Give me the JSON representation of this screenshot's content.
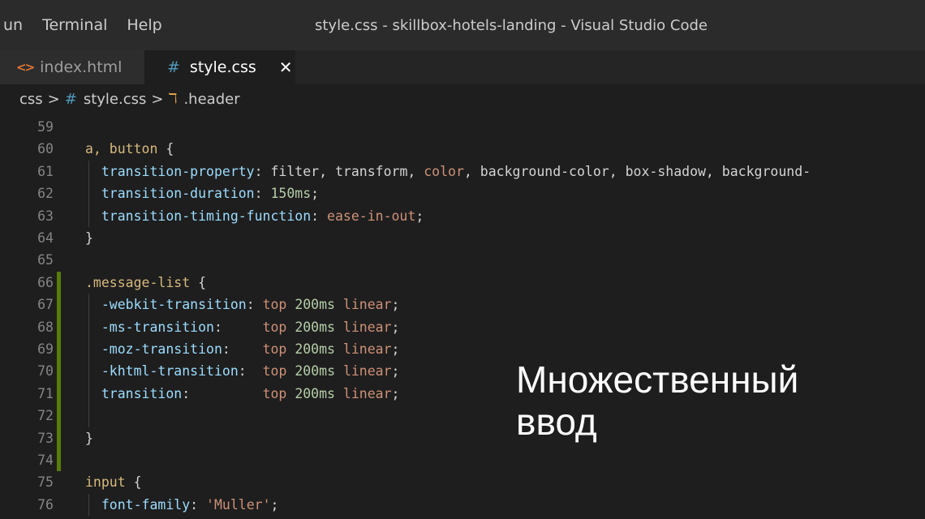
{
  "menu": [
    "un",
    "Terminal",
    "Help"
  ],
  "window_title": "style.css - skillbox-hotels-landing - Visual Studio Code",
  "tabs": [
    {
      "label": "index.html",
      "icon": "<>"
    },
    {
      "label": "style.css",
      "icon": "#",
      "close": "✕"
    }
  ],
  "breadcrumb": {
    "folder": "css",
    "sep": ">",
    "file_icon": "#",
    "file": "style.css",
    "symbol_icon": "ℸ",
    "symbol": ".header"
  },
  "lines": [
    {
      "n": "59",
      "tokens": []
    },
    {
      "n": "60",
      "tokens": [
        [
          "sel",
          "a, button "
        ],
        [
          "punc",
          "{"
        ]
      ]
    },
    {
      "n": "61",
      "tokens": [
        [
          "pad",
          "  "
        ],
        [
          "prop",
          "transition-property"
        ],
        [
          "punc",
          ": "
        ],
        [
          "punc",
          "filter, transform, "
        ],
        [
          "val",
          "color"
        ],
        [
          "punc",
          ", background-color, box-shadow, background-"
        ]
      ]
    },
    {
      "n": "62",
      "tokens": [
        [
          "pad",
          "  "
        ],
        [
          "prop",
          "transition-duration"
        ],
        [
          "punc",
          ": "
        ],
        [
          "num",
          "150ms"
        ],
        [
          "punc",
          ";"
        ]
      ]
    },
    {
      "n": "63",
      "tokens": [
        [
          "pad",
          "  "
        ],
        [
          "prop",
          "transition-timing-function"
        ],
        [
          "punc",
          ": "
        ],
        [
          "val",
          "ease-in-out"
        ],
        [
          "punc",
          ";"
        ]
      ]
    },
    {
      "n": "64",
      "tokens": [
        [
          "punc",
          "}"
        ]
      ]
    },
    {
      "n": "65",
      "tokens": []
    },
    {
      "n": "66",
      "tokens": [
        [
          "sel",
          ".message-list "
        ],
        [
          "punc",
          "{"
        ]
      ]
    },
    {
      "n": "67",
      "tokens": [
        [
          "pad",
          "  "
        ],
        [
          "prop",
          "-webkit-transition"
        ],
        [
          "punc",
          ": "
        ],
        [
          "val",
          "top "
        ],
        [
          "num",
          "200ms "
        ],
        [
          "val",
          "linear"
        ],
        [
          "punc",
          ";"
        ]
      ]
    },
    {
      "n": "68",
      "tokens": [
        [
          "pad",
          "  "
        ],
        [
          "prop",
          "-ms-transition"
        ],
        [
          "punc",
          ":     "
        ],
        [
          "val",
          "top "
        ],
        [
          "num",
          "200ms "
        ],
        [
          "val",
          "linear"
        ],
        [
          "punc",
          ";"
        ]
      ]
    },
    {
      "n": "69",
      "tokens": [
        [
          "pad",
          "  "
        ],
        [
          "prop",
          "-moz-transition"
        ],
        [
          "punc",
          ":    "
        ],
        [
          "val",
          "top "
        ],
        [
          "num",
          "200ms "
        ],
        [
          "val",
          "linear"
        ],
        [
          "punc",
          ";"
        ]
      ]
    },
    {
      "n": "70",
      "tokens": [
        [
          "pad",
          "  "
        ],
        [
          "prop",
          "-khtml-transition"
        ],
        [
          "punc",
          ":  "
        ],
        [
          "val",
          "top "
        ],
        [
          "num",
          "200ms "
        ],
        [
          "val",
          "linear"
        ],
        [
          "punc",
          ";"
        ]
      ]
    },
    {
      "n": "71",
      "tokens": [
        [
          "pad",
          "  "
        ],
        [
          "prop",
          "transition"
        ],
        [
          "punc",
          ":         "
        ],
        [
          "val",
          "top "
        ],
        [
          "num",
          "200ms "
        ],
        [
          "val",
          "linear"
        ],
        [
          "punc",
          ";"
        ]
      ]
    },
    {
      "n": "72",
      "tokens": []
    },
    {
      "n": "73",
      "tokens": [
        [
          "punc",
          "}"
        ]
      ]
    },
    {
      "n": "74",
      "tokens": []
    },
    {
      "n": "75",
      "tokens": [
        [
          "sel",
          "input "
        ],
        [
          "punc",
          "{"
        ]
      ]
    },
    {
      "n": "76",
      "tokens": [
        [
          "pad",
          "  "
        ],
        [
          "prop",
          "font-family"
        ],
        [
          "punc",
          ": "
        ],
        [
          "val",
          "'Muller'"
        ],
        [
          "punc",
          ";"
        ]
      ]
    }
  ],
  "overlay": [
    "Множественный",
    "ввод"
  ],
  "colors": {
    "selector": "#d7ba7d",
    "property": "#9cdcfe",
    "string_value": "#ce9178",
    "number": "#b5cea8",
    "gutter_modified": "#587c0c"
  }
}
